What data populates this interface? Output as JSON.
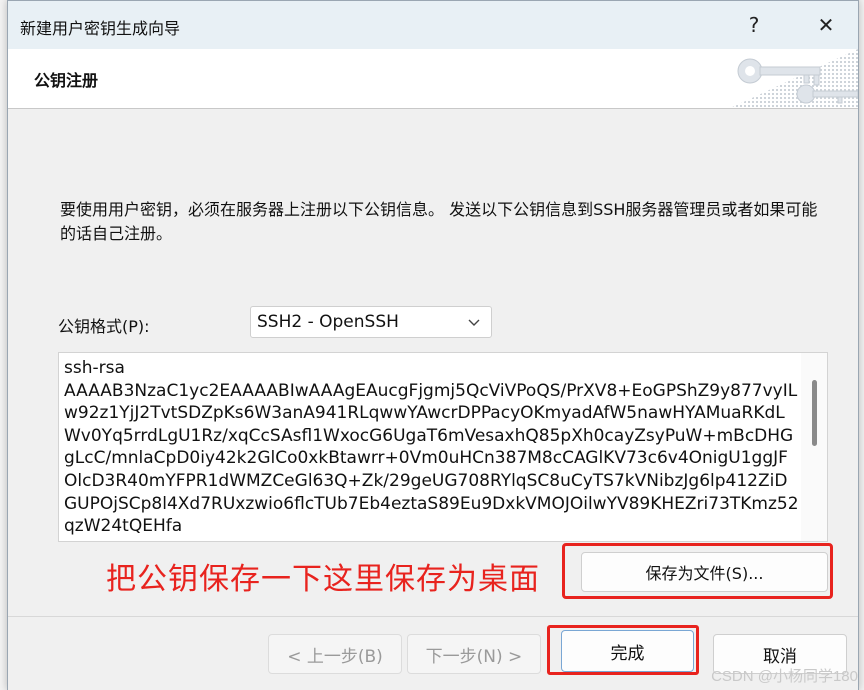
{
  "window": {
    "title": "新建用户密钥生成向导",
    "help_symbol": "?",
    "close_symbol": "✕"
  },
  "header": {
    "title": "公钥注册"
  },
  "content": {
    "instructions": "要使用用户密钥，必须在服务器上注册以下公钥信息。 发送以下公钥信息到SSH服务器管理员或者如果可能的话自己注册。",
    "format_label": "公钥格式(P):",
    "format_selected": "SSH2 - OpenSSH",
    "key_text": "ssh-rsa\nAAAAB3NzaC1yc2EAAAABIwAAAgEAucgFjgmj5QcViVPoQS/PrXV8+EoGPShZ9y877vyILw92z1YjJ2TvtSDZpKs6W3anA941RLqwwYAwcrDPPacyOKmyadAfW5nawHYAMuaRKdLWv0Yq5rrdLgU1Rz/xqCcSAsfl1WxocG6UgaT6mVesaxhQ85pXh0cayZsyPuW+mBcDHGgLcC/mnlaCpD0iy42k2GlCo0xkBtawrr+0Vm0uHCn387M8cCAGlKV73c6v4OnigU1ggJFOlcD3R40mYFPR1dWMZCeGl63Q+Zk/29geUG708RYlqSC8uCyTS7kVNibzJg6lp412ZiDGUPOjSCp8l4Xd7RUxzwio6flcTUb7Eb4eztaS89Eu9DxkVMOJOilwYV89KHEZri73TKmz52qzW24tQEHfa",
    "save_button": "保存为文件(S)..."
  },
  "annotation": {
    "text": "把公钥保存一下这里保存为桌面",
    "color": "#e8231e"
  },
  "footer": {
    "back_button": "< 上一步(B)",
    "next_button": "下一步(N) >",
    "finish_button": "完成",
    "cancel_button": "取消"
  },
  "watermark": "CSDN @小杨同学180"
}
